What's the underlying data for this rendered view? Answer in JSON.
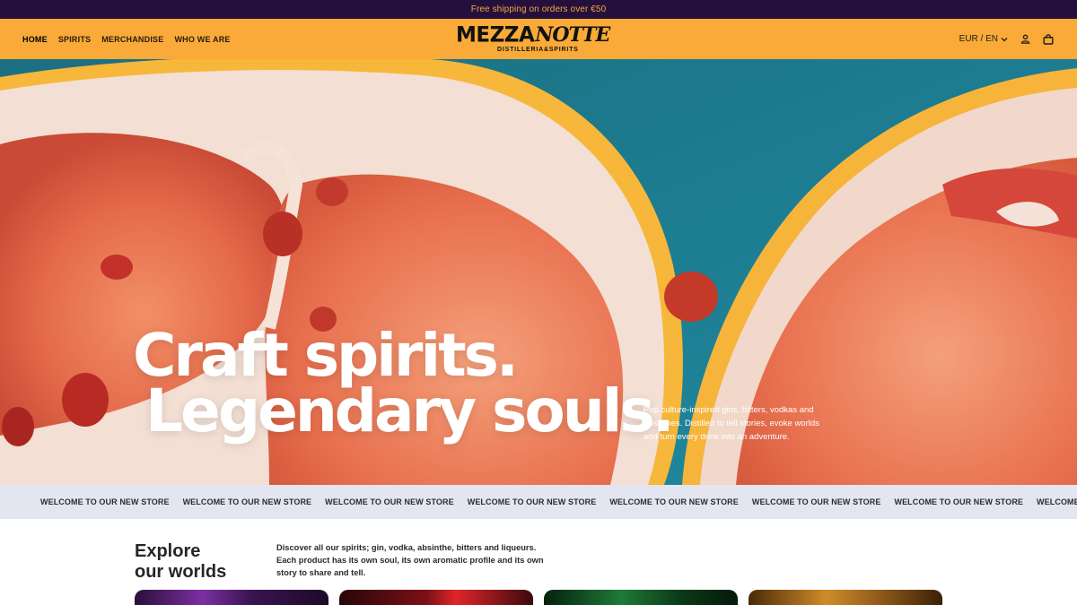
{
  "announcement": "Free shipping on orders over €50",
  "nav": {
    "items": [
      {
        "label": "HOME",
        "active": true
      },
      {
        "label": "SPIRITS",
        "active": false
      },
      {
        "label": "MERCHANDISE",
        "active": false
      },
      {
        "label": "WHO WE ARE",
        "active": false
      }
    ]
  },
  "logo": {
    "word1": "MEZZA",
    "word2": "NOTTE",
    "tagline": "DISTILLERIA&SPIRITS"
  },
  "header_tools": {
    "currency_language": "EUR / EN",
    "account_icon": "user-icon",
    "cart_icon": "bag-icon"
  },
  "hero": {
    "title_line1": "Craft spirits.",
    "title_line2": "Legendary souls.",
    "description": "Pop culture-inspired gins, bitters, vodkas and absinthes. Distilled to tell stories, evoke worlds and turn every drink into an adventure."
  },
  "marquee": {
    "items": [
      "WELCOME TO OUR NEW STORE",
      "WELCOME TO OUR NEW STORE",
      "WELCOME TO OUR NEW STORE",
      "WELCOME TO OUR NEW STORE",
      "WELCOME TO OUR NEW STORE",
      "WELCOME TO OUR NEW STORE",
      "WELCOME TO OUR NEW STORE",
      "WELCOME TO OUR NEW STORE"
    ]
  },
  "explore": {
    "title_line1": "Explore",
    "title_line2": "our worlds",
    "description": "Discover all our spirits; gin, vodka, absinthe, bitters and liqueurs. Each product has its own soul, its own aromatic profile and its own story to share and tell."
  },
  "colors": {
    "announcement_bg": "#25103d",
    "announcement_text": "#f3a93a",
    "header_bg": "#f9aa38",
    "marquee_bg": "#e3e6f0",
    "hero_bg": "#1f8195"
  }
}
